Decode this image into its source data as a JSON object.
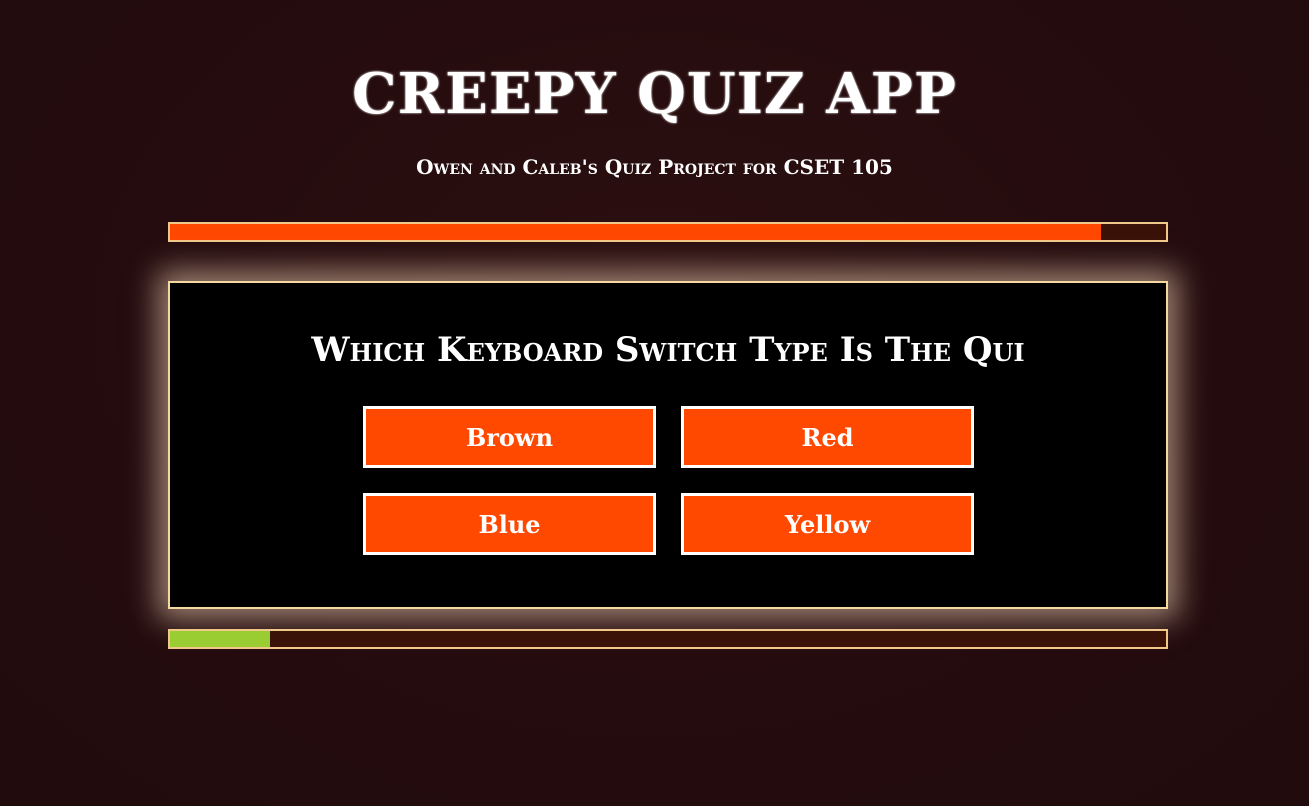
{
  "header": {
    "title": "CREEPY QUIZ APP",
    "subtitle": "Owen and Caleb's Quiz Project for CSET 105"
  },
  "timer": {
    "fraction_remaining": 0.935
  },
  "question": {
    "text": "Which Keyboard Switch Type Is The Qui"
  },
  "answers": [
    {
      "label": "Brown"
    },
    {
      "label": "Red"
    },
    {
      "label": "Blue"
    },
    {
      "label": "Yellow"
    }
  ],
  "progress": {
    "fraction_complete": 0.1
  },
  "colors": {
    "accent": "#ff4800",
    "progress": "#9acd32",
    "border": "#f5d9a0",
    "background": "#250c0e"
  }
}
